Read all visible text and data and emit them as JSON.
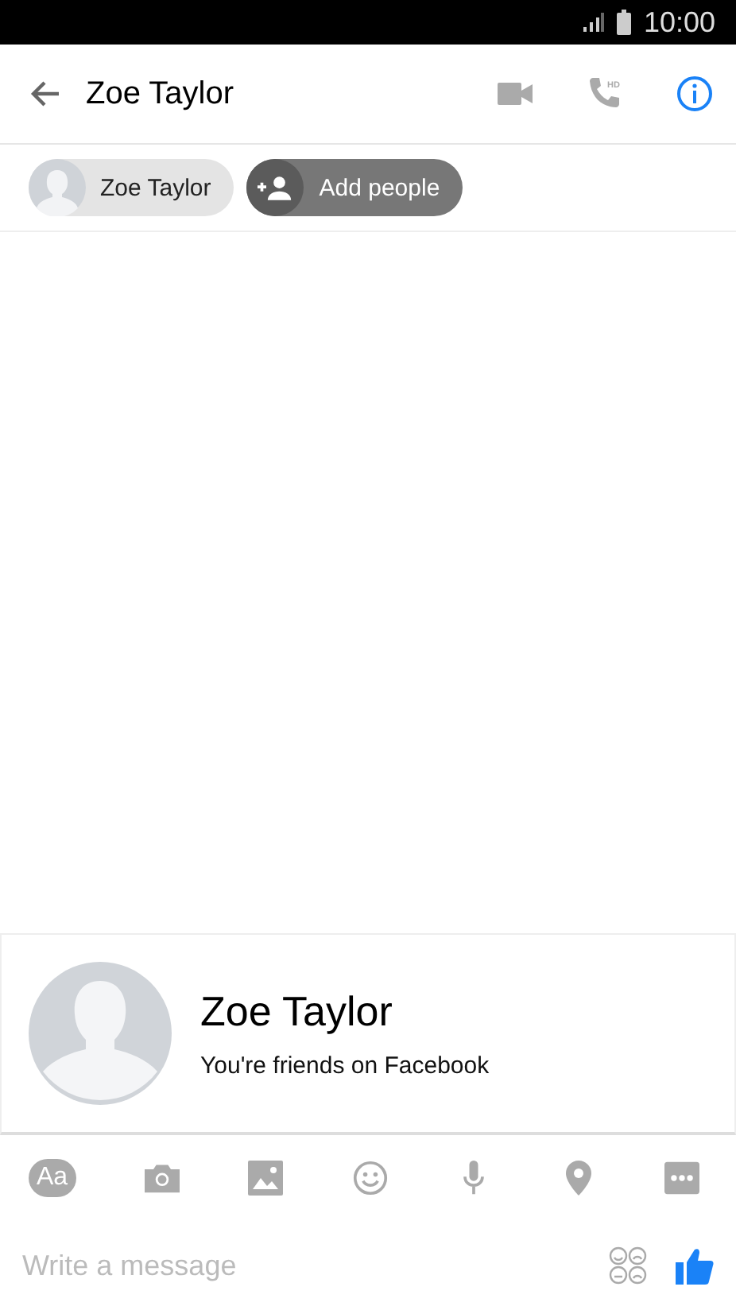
{
  "status_bar": {
    "time": "10:00"
  },
  "header": {
    "title": "Zoe Taylor",
    "call_badge": "HD"
  },
  "participants": [
    {
      "kind": "person",
      "label": "Zoe Taylor"
    },
    {
      "kind": "add",
      "label": "Add people"
    }
  ],
  "profile_card": {
    "name": "Zoe Taylor",
    "subtitle": "You're friends on Facebook"
  },
  "toolbar": [
    {
      "kind": "text",
      "label": "Aa"
    },
    {
      "kind": "camera"
    },
    {
      "kind": "image"
    },
    {
      "kind": "emoji"
    },
    {
      "kind": "mic"
    },
    {
      "kind": "location"
    },
    {
      "kind": "more"
    }
  ],
  "composer": {
    "placeholder": "Write a message"
  }
}
